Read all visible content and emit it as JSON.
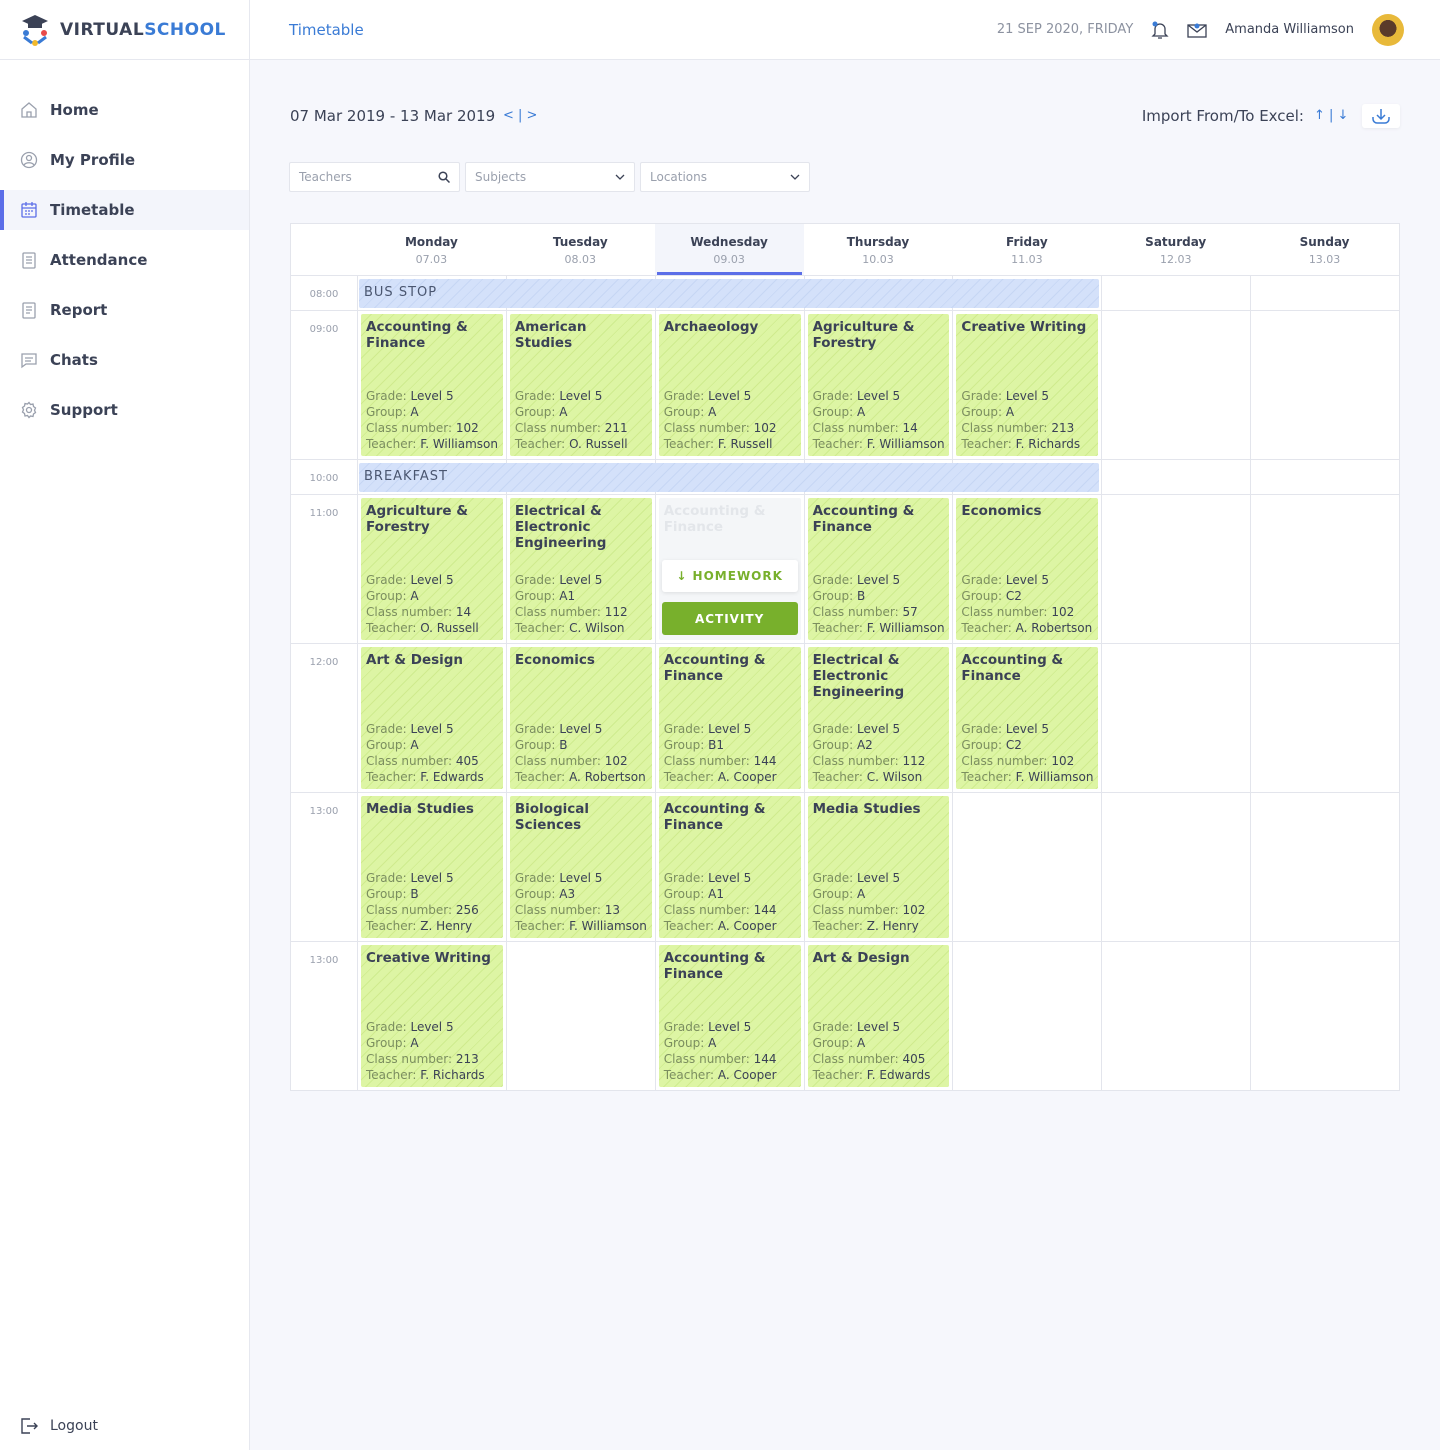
{
  "brand": {
    "part1": "VIRTUAL",
    "part2": "SCHOOL"
  },
  "sidebar": {
    "items": [
      {
        "label": "Home",
        "icon": "home-icon"
      },
      {
        "label": "My Profile",
        "icon": "user-icon"
      },
      {
        "label": "Timetable",
        "icon": "calendar-icon",
        "active": true
      },
      {
        "label": "Attendance",
        "icon": "clipboard-icon"
      },
      {
        "label": "Report",
        "icon": "report-icon"
      },
      {
        "label": "Chats",
        "icon": "chat-icon"
      },
      {
        "label": "Support",
        "icon": "gear-icon"
      }
    ],
    "logout": "Logout"
  },
  "header": {
    "title": "Timetable",
    "date": "21 SEP 2020, FRIDAY",
    "user": "Amanda Williamson"
  },
  "toolbar": {
    "range": "07 Mar 2019 - 13 Mar 2019",
    "range_nav": "< | >",
    "import_label": "Import From/To Excel:",
    "import_arrows": "↑ | ↓"
  },
  "filters": {
    "teachers": "Teachers",
    "subjects": "Subjects",
    "locations": "Locations"
  },
  "colors": {
    "accent": "#3a7bd5",
    "active": "#5b6ee8",
    "class": "#ddf5a4",
    "break": "#d4e1fa",
    "activity": "#78b02c"
  },
  "labels": {
    "grade": "Grade:",
    "group": "Group:",
    "class": "Class number:",
    "teacher": "Teacher:",
    "homework": "↓ HOMEWORK",
    "activity": "ACTIVITY"
  },
  "days": [
    {
      "name": "Monday",
      "date": "07.03"
    },
    {
      "name": "Tuesday",
      "date": "08.03"
    },
    {
      "name": "Wednesday",
      "date": "09.03",
      "today": true
    },
    {
      "name": "Thursday",
      "date": "10.03"
    },
    {
      "name": "Friday",
      "date": "11.03"
    },
    {
      "name": "Saturday",
      "date": "12.03"
    },
    {
      "name": "Sunday",
      "date": "13.03"
    }
  ],
  "rows": [
    {
      "time": "08:00",
      "break": "BUS STOP"
    },
    {
      "time": "09:00",
      "cells": [
        {
          "title": "Accounting & Finance",
          "grade": "Level 5",
          "group": "A",
          "class": "102",
          "teacher": "F. Williamson"
        },
        {
          "title": "American Studies",
          "grade": "Level 5",
          "group": "A",
          "class": "211",
          "teacher": "O. Russell"
        },
        {
          "title": "Archaeology",
          "grade": "Level 5",
          "group": "A",
          "class": "102",
          "teacher": "F. Russell"
        },
        {
          "title": "Agriculture & Forestry",
          "grade": "Level 5",
          "group": "A",
          "class": "14",
          "teacher": "F. Williamson"
        },
        {
          "title": "Creative Writing",
          "grade": "Level 5",
          "group": "A",
          "class": "213",
          "teacher": "F. Richards"
        },
        null,
        null
      ]
    },
    {
      "time": "10:00",
      "break": "BREAKFAST"
    },
    {
      "time": "11:00",
      "cells": [
        {
          "title": "Agriculture & Forestry",
          "grade": "Level 5",
          "group": "A",
          "class": "14",
          "teacher": "O. Russell"
        },
        {
          "title": "Electrical & Electronic Engineering",
          "grade": "Level 5",
          "group": "A1",
          "class": "112",
          "teacher": "C. Wilson"
        },
        {
          "title": "Accounting & Finance",
          "hover": true
        },
        {
          "title": "Accounting & Finance",
          "grade": "Level 5",
          "group": "B",
          "class": "57",
          "teacher": "F. Williamson"
        },
        {
          "title": "Economics",
          "grade": "Level 5",
          "group": "C2",
          "class": "102",
          "teacher": "A. Robertson"
        },
        null,
        null
      ]
    },
    {
      "time": "12:00",
      "cells": [
        {
          "title": "Art & Design",
          "grade": "Level 5",
          "group": "A",
          "class": "405",
          "teacher": "F. Edwards"
        },
        {
          "title": "Economics",
          "grade": "Level 5",
          "group": "B",
          "class": "102",
          "teacher": "A. Robertson"
        },
        {
          "title": "Accounting & Finance",
          "grade": "Level 5",
          "group": "B1",
          "class": "144",
          "teacher": "A. Cooper"
        },
        {
          "title": "Electrical & Electronic Engineering",
          "grade": "Level 5",
          "group": "A2",
          "class": "112",
          "teacher": "C. Wilson"
        },
        {
          "title": "Accounting & Finance",
          "grade": "Level 5",
          "group": "C2",
          "class": "102",
          "teacher": "F. Williamson"
        },
        null,
        null
      ]
    },
    {
      "time": "13:00",
      "cells": [
        {
          "title": "Media Studies",
          "grade": "Level 5",
          "group": "B",
          "class": "256",
          "teacher": "Z. Henry"
        },
        {
          "title": "Biological Sciences",
          "grade": "Level 5",
          "group": "A3",
          "class": "13",
          "teacher": "F. Williamson"
        },
        {
          "title": "Accounting & Finance",
          "grade": "Level 5",
          "group": "A1",
          "class": "144",
          "teacher": "A. Cooper"
        },
        {
          "title": "Media Studies",
          "grade": "Level 5",
          "group": "A",
          "class": "102",
          "teacher": "Z. Henry"
        },
        null,
        null,
        null
      ]
    },
    {
      "time": "13:00",
      "cells": [
        {
          "title": "Creative Writing",
          "grade": "Level 5",
          "group": "A",
          "class": "213",
          "teacher": "F. Richards"
        },
        null,
        {
          "title": "Accounting & Finance",
          "grade": "Level 5",
          "group": "A",
          "class": "144",
          "teacher": "A. Cooper"
        },
        {
          "title": "Art & Design",
          "grade": "Level 5",
          "group": "A",
          "class": "405",
          "teacher": "F. Edwards"
        },
        null,
        null,
        null
      ]
    }
  ]
}
